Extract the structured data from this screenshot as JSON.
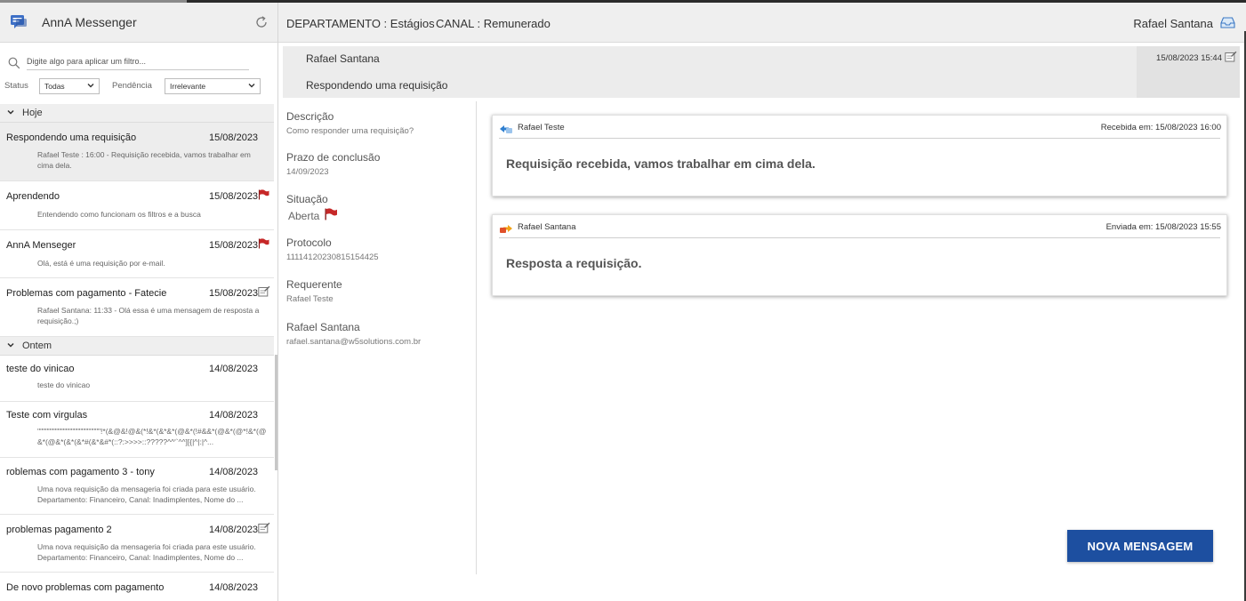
{
  "app": {
    "title": "AnnA Messenger",
    "icons": {
      "app": "chat-icon",
      "refresh": "refresh-icon"
    }
  },
  "sidebar": {
    "search_placeholder": "Digite algo para aplicar um filtro...",
    "filters": {
      "status_label": "Status",
      "status_value": "Todas",
      "pendencia_label": "Pendência",
      "pendencia_value": "Irrelevante"
    },
    "groups": [
      {
        "label": "Hoje",
        "items": [
          {
            "title": "Respondendo uma requisição",
            "date": "15/08/2023",
            "preview": "Rafael Teste : 16:00 - Requisição recebida, vamos trabalhar em cima dela.",
            "icon": "none",
            "selected": true
          },
          {
            "title": "Aprendendo",
            "date": "15/08/2023",
            "preview": "Entendendo como funcionam os filtros e a busca",
            "icon": "flag-icon"
          },
          {
            "title": "AnnA Menseger",
            "date": "15/08/2023",
            "preview": "Olá, está é uma requisição por e-mail.",
            "icon": "flag-icon"
          },
          {
            "title": "Problemas com pagamento - Fatecie",
            "date": "15/08/2023",
            "preview": "Rafael Santana: 11:33 - Olá essa é uma mensagem de resposta a requisição.;)",
            "icon": "edit-note-icon"
          }
        ]
      },
      {
        "label": "Ontem",
        "items": [
          {
            "title": "teste do vinicao",
            "date": "14/08/2023",
            "preview": "teste do vinicao",
            "icon": "none"
          },
          {
            "title": "Teste com virgulas",
            "date": "14/08/2023",
            "preview": "'\"\"\"\"\"\"\"\"\"\"\"\"\"\"\"\"\"\"\"\"\"\"\"!*(&@&!@&(*!&*(&*&*(@&*(!#&&*(@&*(@*!&*(@&*(@&*(&*(&*#(&*&#*(::?:>>>>::?????^^'`^^][{|^|:|^...",
            "icon": "none"
          },
          {
            "title": "roblemas com pagamento 3 - tony",
            "date": "14/08/2023",
            "preview": "Uma nova requisição da mensageria foi criada para este usuário. Departamento: Financeiro, Canal: Inadimplentes, Nome do ...",
            "icon": "none"
          },
          {
            "title": "problemas pagamento 2",
            "date": "14/08/2023",
            "preview": "Uma nova requisição da mensageria foi criada para este usuário. Departamento: Financeiro, Canal: Inadimplentes, Nome do ...",
            "icon": "edit-note-icon"
          },
          {
            "title": "De novo problemas com pagamento",
            "date": "14/08/2023",
            "preview": "",
            "icon": "none"
          }
        ]
      }
    ]
  },
  "header": {
    "departamento": "DEPARTAMENTO : Estágios",
    "canal": "CANAL : Remunerado",
    "user": "Rafael Santana",
    "icons": {
      "inbox": "inbox-icon"
    }
  },
  "request": {
    "name": "Rafael Santana",
    "subject": "Respondendo uma requisição",
    "date": "15/08/2023 15:44"
  },
  "details": {
    "descricao_label": "Descrição",
    "descricao_value": "Como responder uma requisição?",
    "prazo_label": "Prazo de conclusão",
    "prazo_value": "14/09/2023",
    "situacao_label": "Situação",
    "situacao_value": "Aberta",
    "protocolo_label": "Protocolo",
    "protocolo_value": "11114120230815154425",
    "requerente_label": "Requerente",
    "requerente_value": "Rafael Teste",
    "contact_name": "Rafael Santana",
    "contact_email": "rafael.santana@w5solutions.com.br"
  },
  "messages": [
    {
      "sender": "Rafael Teste",
      "date_text": "Recebida em: 15/08/2023 16:00",
      "body": "Requisição recebida, vamos trabalhar em cima dela.",
      "icon": "received-message-icon"
    },
    {
      "sender": "Rafael Santana",
      "date_text": "Enviada em: 15/08/2023 15:55",
      "body": "Resposta a requisição.",
      "icon": "sent-message-icon"
    }
  ],
  "actions": {
    "new_message": "NOVA MENSAGEM"
  },
  "colors": {
    "accent": "#1d4fa0",
    "flag": "#c62828"
  }
}
